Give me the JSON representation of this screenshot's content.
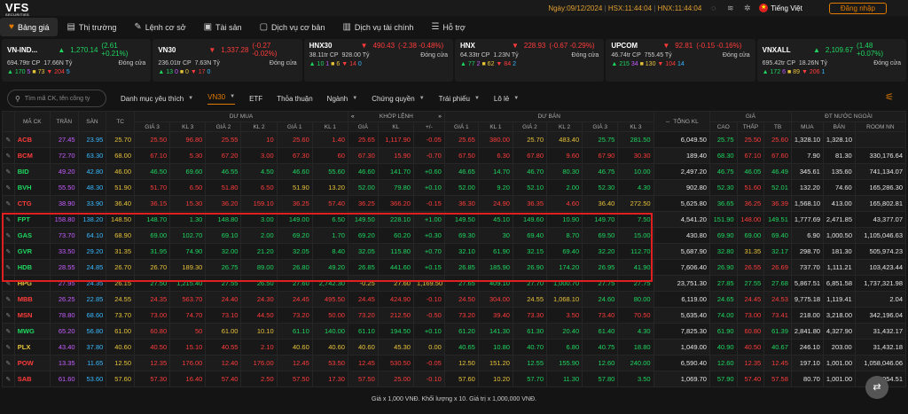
{
  "top": {
    "logo": "VFS",
    "logo_sub": "SECURITIES",
    "date_label": "Ngày:",
    "date": "09/12/2024",
    "hsx_label": "HSX:",
    "hsx_time": "11:44:04",
    "hnx_label": "HNX:",
    "hnx_time": "11:44:04",
    "language": "Tiếng Việt",
    "login": "Đăng nhập"
  },
  "nav": [
    {
      "label": "Bảng giá",
      "icon": "heart-icon",
      "glyph": "♥",
      "active": true
    },
    {
      "label": "Thị trường",
      "icon": "document-icon",
      "glyph": "▤",
      "active": false
    },
    {
      "label": "Lệnh cơ sở",
      "icon": "handshake-icon",
      "glyph": "✎",
      "active": false
    },
    {
      "label": "Tài sản",
      "icon": "wallet-icon",
      "glyph": "▣",
      "active": false
    },
    {
      "label": "Dịch vụ cơ bản",
      "icon": "briefcase-icon",
      "glyph": "▢",
      "active": false
    },
    {
      "label": "Dịch vụ tài chính",
      "icon": "bank-icon",
      "glyph": "▥",
      "active": false
    },
    {
      "label": "Hỗ trợ",
      "icon": "support-icon",
      "glyph": "☰",
      "active": false
    }
  ],
  "indices": [
    {
      "name": "VN-IND...",
      "value": "1,270.14",
      "change": "(2.61 +0.21%)",
      "dir": "up",
      "vol": "694.79tr CP",
      "val": "17.66N Tỷ",
      "status": "Đóng cửa",
      "up": "170",
      "ce": "5",
      "ref": "73",
      "dn": "204",
      "fl": "5"
    },
    {
      "name": "VN30",
      "value": "1,337.28",
      "change": "(-0.27 -0.02%)",
      "dir": "dn",
      "vol": "236.01tr CP",
      "val": "7.63N Tỷ",
      "status": "Đóng cửa",
      "up": "13",
      "ce": "0",
      "ref": "0",
      "dn": "17",
      "fl": "0"
    },
    {
      "name": "HNX30",
      "value": "490.43",
      "change": "(-2.38 -0.48%)",
      "dir": "dn",
      "vol": "38.11tr CP",
      "val": "928.00 Tỷ",
      "status": "Đóng cửa",
      "up": "10",
      "ce": "1",
      "ref": "6",
      "dn": "14",
      "fl": "0"
    },
    {
      "name": "HNX",
      "value": "228.93",
      "change": "(-0.67 -0.29%)",
      "dir": "dn",
      "vol": "64.33tr CP",
      "val": "1.23N Tỷ",
      "status": "Đóng cửa",
      "up": "77",
      "ce": "2",
      "ref": "62",
      "dn": "84",
      "fl": "2"
    },
    {
      "name": "UPCOM",
      "value": "92.81",
      "change": "(-0.15 -0.16%)",
      "dir": "dn",
      "vol": "46.74tr CP",
      "val": "755.45 Tỷ",
      "status": "Đóng cửa",
      "up": "215",
      "ce": "34",
      "ref": "130",
      "dn": "104",
      "fl": "14"
    },
    {
      "name": "VNXALL",
      "value": "2,109.67",
      "change": "(1.48 +0.07%)",
      "dir": "up",
      "vol": "695.42tr CP",
      "val": "18.26N Tỷ",
      "status": "Đóng cửa",
      "up": "172",
      "ce": "6",
      "ref": "89",
      "dn": "206",
      "fl": "1"
    }
  ],
  "filters": {
    "search_placeholder": "Tìm mã CK, tên công ty",
    "items": [
      "Danh mục yêu thích",
      "VN30",
      "ETF",
      "Thỏa thuận",
      "Ngành",
      "Chứng quyền",
      "Trái phiếu",
      "Lô lẻ"
    ],
    "active_index": 1
  },
  "table": {
    "group_headers": {
      "buy": "DƯ MUA",
      "match": "KHỚP LỆNH",
      "sell": "DƯ BÁN",
      "price": "GIÁ",
      "foreign": "ĐT NƯỚC NGOÀI"
    },
    "headers": [
      "MÃ CK",
      "TRẦN",
      "SÀN",
      "TC",
      "GIÁ 3",
      "KL 3",
      "GIÁ 2",
      "KL 2",
      "GIÁ 1",
      "KL 1",
      "GIÁ",
      "KL",
      "+/-",
      "GIÁ 1",
      "KL 1",
      "GIÁ 2",
      "KL 2",
      "GIÁ 3",
      "KL 3",
      "TỔNG KL",
      "CAO",
      "THẤP",
      "TB",
      "MUA",
      "BÁN",
      "ROOM NN"
    ],
    "rows": [
      {
        "s": "ACB",
        "c": [
          "27.45",
          "23.95",
          "25.70",
          "25.50",
          "96.80",
          "25.55",
          "10",
          "25.60",
          "1.40",
          "25.65",
          "1,117.90",
          "-0.05",
          "25.65",
          "380.00",
          "25.70",
          "483.40",
          "25.75",
          "281.50",
          "6,049.50",
          "25.75",
          "25.50",
          "25.60",
          "1,328.10",
          "1,328.10",
          ""
        ]
      },
      {
        "s": "BCM",
        "c": [
          "72.70",
          "63.30",
          "68.00",
          "67.10",
          "5.30",
          "67.20",
          "3.00",
          "67.30",
          "60",
          "67.30",
          "15.90",
          "-0.70",
          "67.50",
          "6.30",
          "67.80",
          "9.60",
          "67.90",
          "30.30",
          "189.40",
          "68.30",
          "67.10",
          "67.60",
          "7.90",
          "81.30",
          "330,176.64"
        ]
      },
      {
        "s": "BID",
        "c": [
          "49.20",
          "42.80",
          "46.00",
          "46.50",
          "69.60",
          "46.55",
          "4.50",
          "46.60",
          "55.60",
          "46.60",
          "141.70",
          "+0.60",
          "46.65",
          "14.70",
          "46.70",
          "80.30",
          "46.75",
          "10.00",
          "2,497.20",
          "46.75",
          "46.05",
          "46.49",
          "345.61",
          "135.60",
          "741,134.07"
        ]
      },
      {
        "s": "BVH",
        "c": [
          "55.50",
          "48.30",
          "51.90",
          "51.70",
          "6.50",
          "51.80",
          "6.50",
          "51.90",
          "13.20",
          "52.00",
          "79.80",
          "+0.10",
          "52.00",
          "9.20",
          "52.10",
          "2.00",
          "52.30",
          "4.30",
          "902.80",
          "52.30",
          "51.60",
          "52.01",
          "132.20",
          "74.60",
          "165,286.30"
        ]
      },
      {
        "s": "CTG",
        "c": [
          "38.90",
          "33.90",
          "36.40",
          "36.15",
          "15.30",
          "36.20",
          "159.10",
          "36.25",
          "57.40",
          "36.25",
          "366.20",
          "-0.15",
          "36.30",
          "24.90",
          "36.35",
          "4.60",
          "36.40",
          "272.50",
          "5,625.80",
          "36.65",
          "36.25",
          "36.39",
          "1,568.10",
          "413.00",
          "165,802.81"
        ]
      },
      {
        "s": "FPT",
        "c": [
          "158.80",
          "138.20",
          "148.50",
          "148.70",
          "1.30",
          "148.80",
          "3.00",
          "149.00",
          "6.50",
          "149.50",
          "228.10",
          "+1.00",
          "149.50",
          "45.10",
          "149.60",
          "10.90",
          "149.70",
          "7.50",
          "4,541.20",
          "151.90",
          "148.00",
          "149.51",
          "1,777.69",
          "2,471.85",
          "43,377.07"
        ]
      },
      {
        "s": "GAS",
        "c": [
          "73.70",
          "64.10",
          "68.90",
          "69.00",
          "102.70",
          "69.10",
          "2.00",
          "69.20",
          "1.70",
          "69.20",
          "60.20",
          "+0.30",
          "69.30",
          "30",
          "69.40",
          "8.70",
          "69.50",
          "15.00",
          "430.80",
          "69.90",
          "69.00",
          "69.40",
          "6.90",
          "1,000.50",
          "1,105,046.63"
        ]
      },
      {
        "s": "GVR",
        "c": [
          "33.50",
          "29.20",
          "31.35",
          "31.95",
          "74.90",
          "32.00",
          "21.20",
          "32.05",
          "8.40",
          "32.05",
          "115.80",
          "+0.70",
          "32.10",
          "61.90",
          "32.15",
          "69.40",
          "32.20",
          "112.70",
          "5,687.90",
          "32.80",
          "31.35",
          "32.17",
          "298.70",
          "181.30",
          "505,974.23"
        ]
      },
      {
        "s": "HDB",
        "c": [
          "28.55",
          "24.85",
          "26.70",
          "26.70",
          "189.30",
          "26.75",
          "89.00",
          "26.80",
          "49.20",
          "26.85",
          "441.60",
          "+0.15",
          "26.85",
          "185.90",
          "26.90",
          "174.20",
          "26.95",
          "41.90",
          "7,606.40",
          "26.90",
          "26.55",
          "26.69",
          "737.70",
          "1,111.21",
          "103,423.44"
        ]
      },
      {
        "s": "HPG",
        "c": [
          "27.95",
          "24.35",
          "26.15",
          "27.50",
          "1,215.40",
          "27.55",
          "26.50",
          "27.60",
          "2,742.30",
          "-0.25",
          "27.60",
          "1,169.50",
          "27.65",
          "409.10",
          "27.70",
          "1,000.70",
          "27.75",
          "27.75",
          "23,751.30",
          "27.85",
          "27.55",
          "27.68",
          "5,867.51",
          "6,851.58",
          "1,737,321.98"
        ]
      },
      {
        "s": "MBB",
        "c": [
          "26.25",
          "22.85",
          "24.55",
          "24.35",
          "563.70",
          "24.40",
          "24.30",
          "24.45",
          "495.50",
          "24.45",
          "424.90",
          "-0.10",
          "24.50",
          "304.00",
          "24.55",
          "1,068.10",
          "24.60",
          "80.00",
          "6,119.00",
          "24.65",
          "24.45",
          "24.53",
          "9,775.18",
          "1,119.41",
          "2.04"
        ]
      },
      {
        "s": "MSN",
        "c": [
          "78.80",
          "68.60",
          "73.70",
          "73.00",
          "74.70",
          "73.10",
          "44.50",
          "73.20",
          "50.00",
          "73.20",
          "212.50",
          "-0.50",
          "73.20",
          "39.40",
          "73.30",
          "3.50",
          "73.40",
          "70.50",
          "5,635.40",
          "74.00",
          "73.00",
          "73.41",
          "218.00",
          "3,218.00",
          "342,196.04"
        ]
      },
      {
        "s": "MWG",
        "c": [
          "65.20",
          "56.80",
          "61.00",
          "60.80",
          "50",
          "61.00",
          "10.10",
          "61.10",
          "140.00",
          "61.10",
          "194.50",
          "+0.10",
          "61.20",
          "141.30",
          "61.30",
          "20.40",
          "61.40",
          "4.30",
          "7,825.30",
          "61.90",
          "60.80",
          "61.39",
          "2,841.80",
          "4,327.90",
          "31,432.17"
        ]
      },
      {
        "s": "PLX",
        "c": [
          "43.40",
          "37.80",
          "40.60",
          "40.50",
          "15.10",
          "40.55",
          "2.10",
          "40.60",
          "40.60",
          "40.60",
          "45.30",
          "0.00",
          "40.65",
          "10.80",
          "40.70",
          "6.80",
          "40.75",
          "18.80",
          "1,049.00",
          "40.90",
          "40.50",
          "40.67",
          "246.10",
          "203.00",
          "31,432.18"
        ]
      },
      {
        "s": "POW",
        "c": [
          "13.35",
          "11.65",
          "12.50",
          "12.35",
          "176.00",
          "12.40",
          "176.00",
          "12.45",
          "53.50",
          "12.45",
          "530.50",
          "-0.05",
          "12.50",
          "151.20",
          "12.55",
          "155.90",
          "12.60",
          "240.00",
          "6,590.40",
          "12.60",
          "12.35",
          "12.45",
          "197.10",
          "1,001.00",
          "1,058,046.06"
        ]
      },
      {
        "s": "SAB",
        "c": [
          "61.60",
          "53.60",
          "57.60",
          "57.30",
          "16.40",
          "57.40",
          "2.50",
          "57.50",
          "17.30",
          "57.50",
          "25.00",
          "-0.10",
          "57.60",
          "10.20",
          "57.70",
          "11.30",
          "57.80",
          "3.50",
          "1,069.70",
          "57.90",
          "57.40",
          "57.58",
          "80.70",
          "1,001.00",
          "96,054.51"
        ]
      }
    ]
  },
  "footer": "Giá x 1,000 VNĐ. Khối lượng x 10. Giá trị x 1,000,000 VNĐ.",
  "colors": {
    "up": "#1ed760",
    "down": "#ff3b3b",
    "ref": "#e8c33a",
    "ceil": "#c55cff",
    "floor": "#37b9ff",
    "accent": "#e07a00"
  }
}
